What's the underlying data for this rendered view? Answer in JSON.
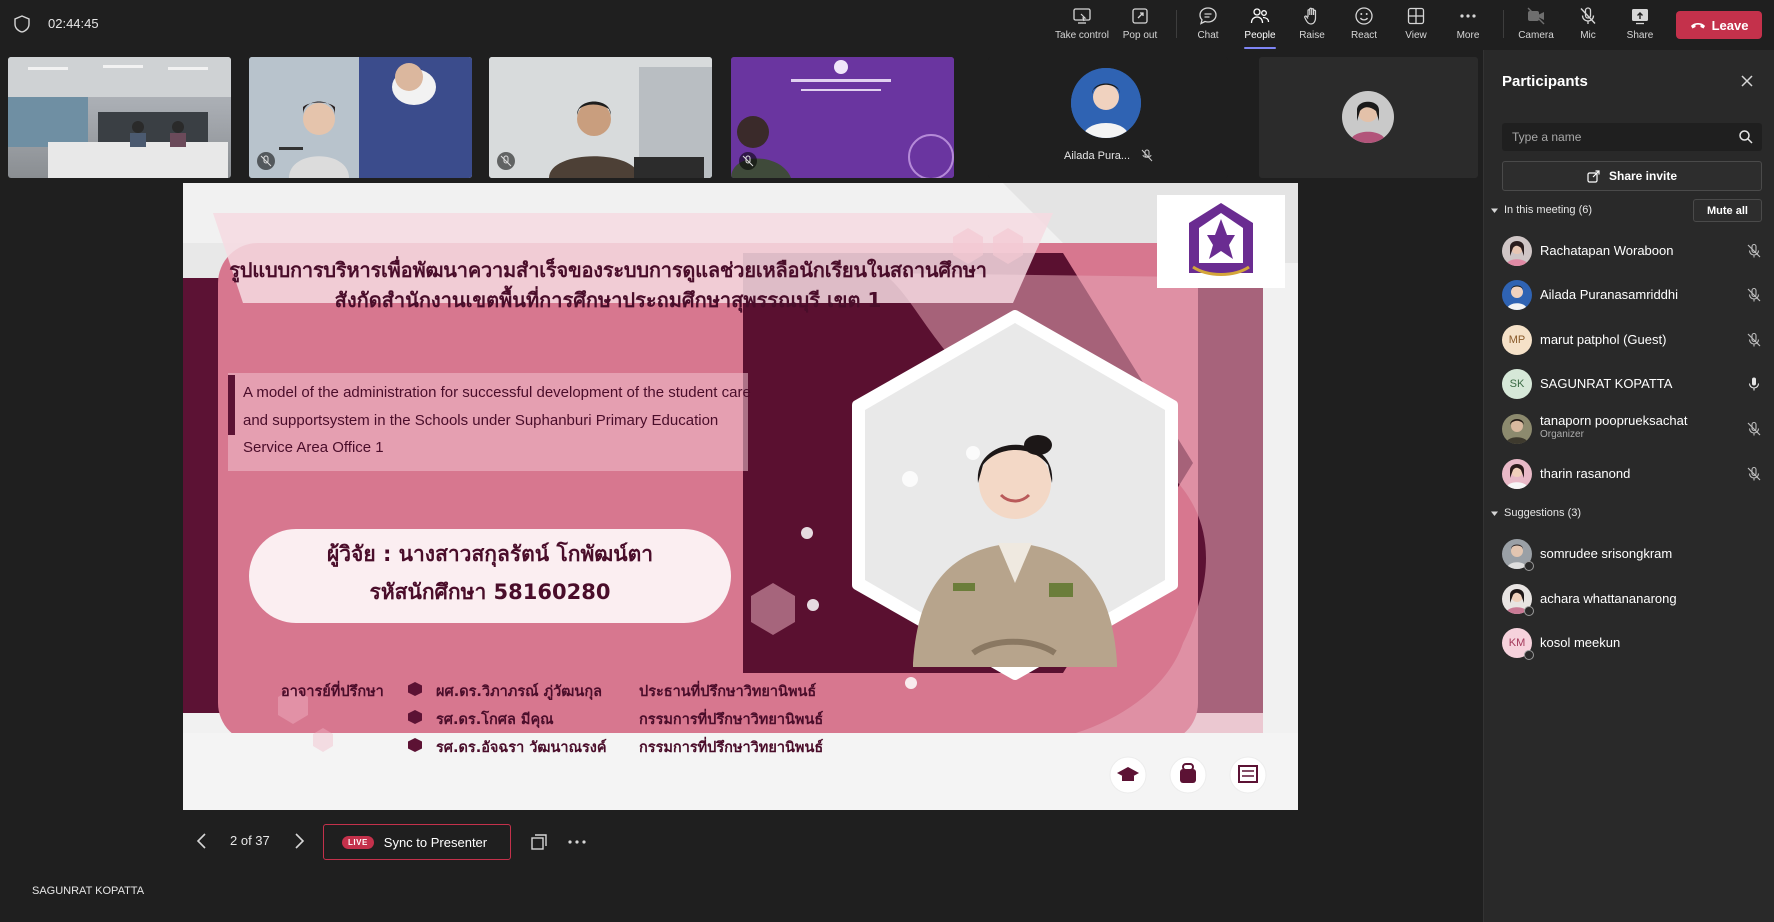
{
  "meeting": {
    "timer": "02:44:45"
  },
  "toolbar": {
    "take_control": "Take control",
    "pop_out": "Pop out",
    "chat": "Chat",
    "people": "People",
    "raise": "Raise",
    "react": "React",
    "view": "View",
    "more": "More",
    "camera": "Camera",
    "mic": "Mic",
    "share": "Share",
    "leave": "Leave"
  },
  "tiles": {
    "ailada_short": "Ailada Pura..."
  },
  "slide": {
    "title_line1": "รูปแบบการบริหารเพื่อพัฒนาความสำเร็จของระบบการดูแลช่วยเหลือนักเรียนในสถานศึกษา",
    "title_line2": "สังกัดสำนักงานเขตพื้นที่การศึกษาประถมศึกษาสุพรรณบุรี เขต 1",
    "english_line1": "A model of the administration for successful development of the student care",
    "english_line2": "and supportsystem in the Schools under Suphanburi Primary Education",
    "english_line3": "Service Area Office 1",
    "researcher": "ผู้วิจัย : นางสาวสกุลรัตน์ โกพัฒน์ตา",
    "student_id": "รหัสนักศึกษา 58160280",
    "advisors_label": "อาจารย์ที่ปรึกษา",
    "advisors": [
      {
        "name": "ผศ.ดร.วิภาภรณ์ ภู่วัฒนกุล",
        "role": "ประธานที่ปรึกษาวิทยานิพนธ์"
      },
      {
        "name": "รศ.ดร.โกศล มีคุณ",
        "role": "กรรมการที่ปรึกษาวิทยานิพนธ์"
      },
      {
        "name": "รศ.ดร.อัจฉรา วัฒนาณรงค์",
        "role": "กรรมการที่ปรึกษาวิทยานิพนธ์"
      }
    ]
  },
  "presentation": {
    "page_indicator": "2 of 37",
    "live_badge": "LIVE",
    "sync_label": "Sync to Presenter",
    "presenter_name": "SAGUNRAT KOPATTA"
  },
  "panel": {
    "title": "Participants",
    "search_placeholder": "Type a name",
    "share_invite": "Share invite",
    "in_meeting_label": "In this meeting (6)",
    "mute_all": "Mute all",
    "suggestions_label": "Suggestions (3)",
    "participants": [
      {
        "name": "Rachatapan Woraboon",
        "sub": "",
        "initials": ""
      },
      {
        "name": "Ailada Puranasamriddhi",
        "sub": "",
        "initials": ""
      },
      {
        "name": "marut patphol (Guest)",
        "sub": "",
        "initials": "MP"
      },
      {
        "name": "SAGUNRAT KOPATTA",
        "sub": "",
        "initials": "SK"
      },
      {
        "name": "tanaporn pooprueksachat",
        "sub": "Organizer",
        "initials": ""
      },
      {
        "name": "tharin rasanond",
        "sub": "",
        "initials": ""
      }
    ],
    "suggestions": [
      {
        "name": "somrudee srisongkram",
        "initials": ""
      },
      {
        "name": "achara whattananarong",
        "initials": ""
      },
      {
        "name": "kosol meekun",
        "initials": "KM"
      }
    ]
  },
  "colors": {
    "leave": "#c4314b",
    "accent": "#7f85f5",
    "slide_pink": "#d8778f",
    "slide_maroon": "#5a1030"
  }
}
